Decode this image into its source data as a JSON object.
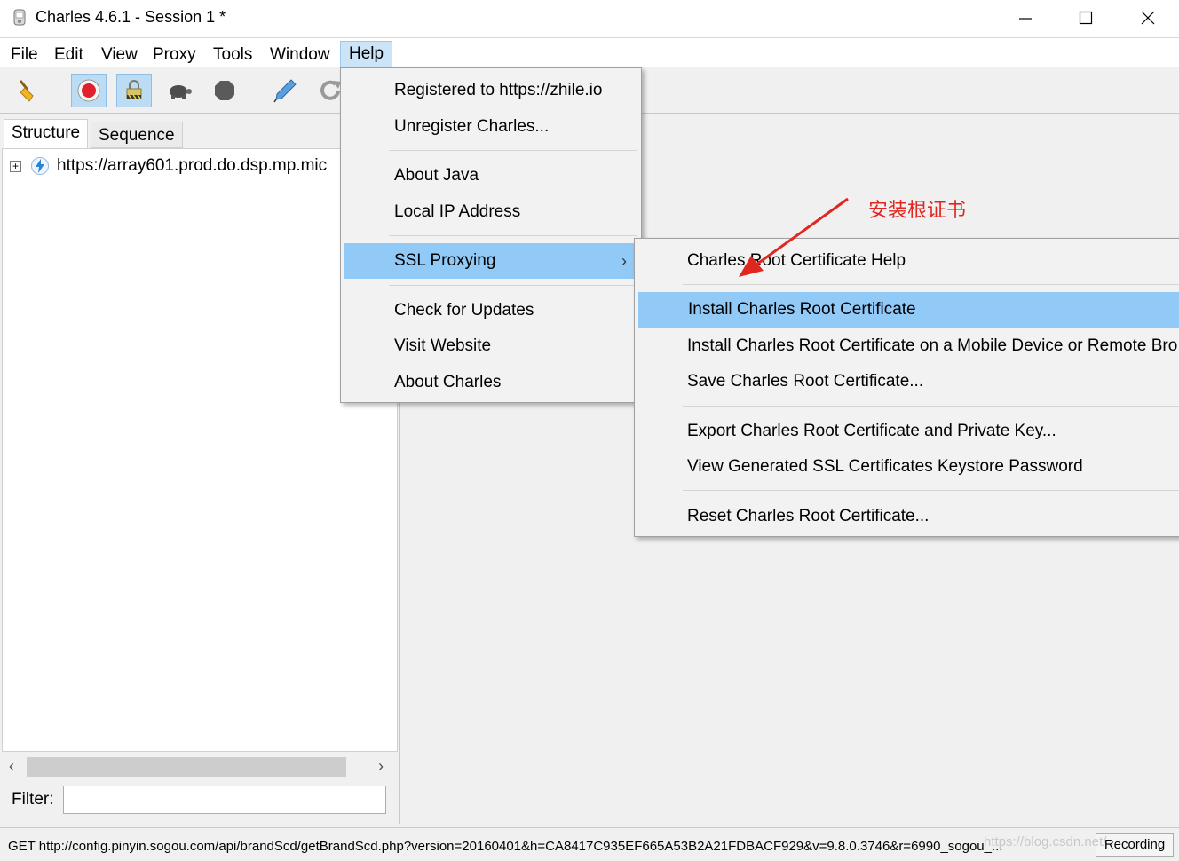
{
  "window": {
    "title": "Charles 4.6.1 - Session 1 *",
    "controls": [
      "minimize",
      "maximize",
      "close"
    ]
  },
  "menubar": {
    "items": [
      {
        "label": "File"
      },
      {
        "label": "Edit"
      },
      {
        "label": "View"
      },
      {
        "label": "Proxy"
      },
      {
        "label": "Tools"
      },
      {
        "label": "Window"
      },
      {
        "label": "Help",
        "active": true
      }
    ]
  },
  "toolbar": {
    "buttons": [
      {
        "icon": "broom-icon"
      },
      {
        "icon": "record-icon",
        "pressed": true
      },
      {
        "icon": "ssl-lock-icon",
        "pressed": true
      },
      {
        "icon": "turtle-icon"
      },
      {
        "icon": "stop-icon"
      },
      {
        "icon": "pen-icon"
      },
      {
        "icon": "refresh-icon"
      }
    ]
  },
  "left_panel": {
    "tabs": [
      {
        "label": "Structure",
        "selected": true
      },
      {
        "label": "Sequence",
        "selected": false
      }
    ],
    "tree": [
      {
        "label": "https://array601.prod.do.dsp.mp.mic",
        "icon": "lightning-globe-icon"
      }
    ],
    "filter_label": "Filter:",
    "filter_value": ""
  },
  "help_menu": {
    "items": [
      {
        "label": "Registered to https://zhile.io"
      },
      {
        "label": "Unregister Charles..."
      },
      {
        "label": "About Java"
      },
      {
        "label": "Local IP Address"
      },
      {
        "label": "SSL Proxying",
        "highlighted": true,
        "submenu": true
      },
      {
        "label": "Check for Updates"
      },
      {
        "label": "Visit Website"
      },
      {
        "label": "About Charles"
      }
    ]
  },
  "ssl_menu": {
    "items": [
      {
        "label": "Charles Root Certificate Help"
      },
      {
        "label": "Install Charles Root Certificate",
        "highlighted": true
      },
      {
        "label": "Install Charles Root Certificate on a Mobile Device or Remote Bro"
      },
      {
        "label": "Save Charles Root Certificate..."
      },
      {
        "label": "Export Charles Root Certificate and Private Key..."
      },
      {
        "label": "View Generated SSL Certificates Keystore Password"
      },
      {
        "label": "Reset Charles Root Certificate..."
      }
    ]
  },
  "annotation": {
    "text": "安装根证书",
    "color": "#e0261f"
  },
  "statusbar": {
    "text": "GET http://config.pinyin.sogou.com/api/brandScd/getBrandScd.php?version=20160401&h=CA8417C935EF665A53B2A21FDBACF929&v=9.8.0.3746&r=6990_sogou_...",
    "recording": "Recording",
    "watermark": "https://blog.csdn.net/"
  },
  "colors": {
    "menu_highlight": "#91c9f7",
    "active_menu": "#cce4f7",
    "record_red": "#e0202a",
    "annotation_red": "#e0261f"
  }
}
